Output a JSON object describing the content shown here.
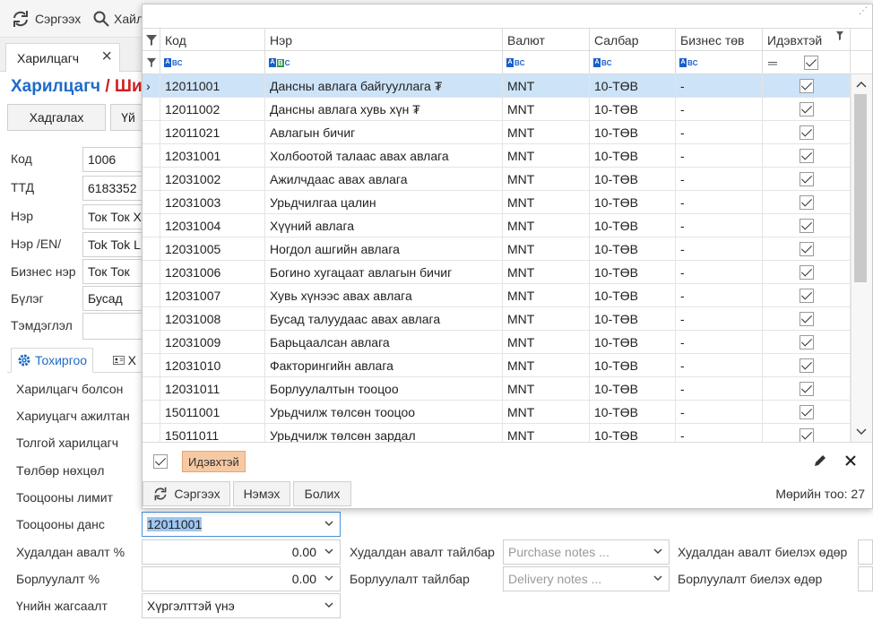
{
  "toolbar": {
    "refresh_label": "Сэргээх",
    "search_label": "Хайл"
  },
  "doc_tab": {
    "label": "Харилцагч"
  },
  "page_title": {
    "main": "Харилцагч",
    "sub": "/ Ши"
  },
  "actions": {
    "save_label": "Хадгалах",
    "other_label": "Үй"
  },
  "form": {
    "code": {
      "label": "Код",
      "value": "1006"
    },
    "ttd": {
      "label": "ТТД",
      "value": "6183352"
    },
    "name": {
      "label": "Нэр",
      "value": "Ток Ток Х"
    },
    "name_en": {
      "label": "Нэр /EN/",
      "value": "Tok Tok L"
    },
    "business_name": {
      "label": "Бизнес нэр",
      "value": "Ток Ток"
    },
    "group": {
      "label": "Бүлэг",
      "value": "Бусад"
    },
    "note": {
      "label": "Тэмдэглэл",
      "value": ""
    }
  },
  "section_tabs": {
    "settings": "Тохиргоо",
    "other": "Х"
  },
  "settings": {
    "became_customer": "Харилцагч болсон",
    "responsible_employee": "Хариуцагч ажилтан",
    "head_customer": "Толгой харилцагч",
    "payment_terms": "Төлбөр нөхцөл",
    "credit_limit": "Тооцооны лимит",
    "account": {
      "label": "Тооцооны данс",
      "value": "12011001"
    },
    "purchase_pct": {
      "label": "Худалдан авалт %",
      "value": "0.00"
    },
    "sales_pct": {
      "label": "Борлуулалт %",
      "value": "0.00"
    },
    "price_list": {
      "label": "Үнийн жагсаалт",
      "value": "Хүргэлттэй үнэ"
    },
    "purchase_note": {
      "label": "Худалдан авалт тайлбар",
      "placeholder": "Purchase notes ..."
    },
    "delivery_note": {
      "label": "Борлуулалт тайлбар",
      "placeholder": "Delivery notes ..."
    },
    "purchase_days": {
      "label": "Худалдан авалт биелэх өдөр"
    },
    "sales_days": {
      "label": "Борлуулалт биелэх өдөр"
    }
  },
  "popup": {
    "columns": [
      "Код",
      "Нэр",
      "Валют",
      "Салбар",
      "Бизнес төв",
      "Идэвхтэй"
    ],
    "rows": [
      {
        "code": "12011001",
        "name": "Дансны авлага байгууллага ₮",
        "currency": "MNT",
        "branch": "10-ТӨВ",
        "bc": "-",
        "active": true
      },
      {
        "code": "12011002",
        "name": "Дансны авлага хувь хүн ₮",
        "currency": "MNT",
        "branch": "10-ТӨВ",
        "bc": "-",
        "active": true
      },
      {
        "code": "12011021",
        "name": "Авлагын бичиг",
        "currency": "MNT",
        "branch": "10-ТӨВ",
        "bc": "-",
        "active": true
      },
      {
        "code": "12031001",
        "name": "Холбоотой талаас авах авлага",
        "currency": "MNT",
        "branch": "10-ТӨВ",
        "bc": "-",
        "active": true
      },
      {
        "code": "12031002",
        "name": "Ажилчдаас авах авлага",
        "currency": "MNT",
        "branch": "10-ТӨВ",
        "bc": "-",
        "active": true
      },
      {
        "code": "12031003",
        "name": "Урьдчилгаа цалин",
        "currency": "MNT",
        "branch": "10-ТӨВ",
        "bc": "-",
        "active": true
      },
      {
        "code": "12031004",
        "name": "Хүүний авлага",
        "currency": "MNT",
        "branch": "10-ТӨВ",
        "bc": "-",
        "active": true
      },
      {
        "code": "12031005",
        "name": "Ногдол ашгийн авлага",
        "currency": "MNT",
        "branch": "10-ТӨВ",
        "bc": "-",
        "active": true
      },
      {
        "code": "12031006",
        "name": "Богино хугацаат авлагын бичиг",
        "currency": "MNT",
        "branch": "10-ТӨВ",
        "bc": "-",
        "active": true
      },
      {
        "code": "12031007",
        "name": "Хувь хүнээс авах авлага",
        "currency": "MNT",
        "branch": "10-ТӨВ",
        "bc": "-",
        "active": true
      },
      {
        "code": "12031008",
        "name": "Бусад талуудаас авах авлага",
        "currency": "MNT",
        "branch": "10-ТӨВ",
        "bc": "-",
        "active": true
      },
      {
        "code": "12031009",
        "name": "Барьцаалсан авлага",
        "currency": "MNT",
        "branch": "10-ТӨВ",
        "bc": "-",
        "active": true
      },
      {
        "code": "12031010",
        "name": "Факторингийн авлага",
        "currency": "MNT",
        "branch": "10-ТӨВ",
        "bc": "-",
        "active": true
      },
      {
        "code": "12031011",
        "name": "Борлуулалтын тооцоо",
        "currency": "MNT",
        "branch": "10-ТӨВ",
        "bc": "-",
        "active": true
      },
      {
        "code": "15011001",
        "name": "Урьдчилж төлсөн тооцоо",
        "currency": "MNT",
        "branch": "10-ТӨВ",
        "bc": "-",
        "active": true
      },
      {
        "code": "15011011",
        "name": "Урьдчилж төлсөн зардал",
        "currency": "MNT",
        "branch": "10-ТӨВ",
        "bc": "-",
        "active": true
      }
    ],
    "filter_badge": "Идэвхтэй",
    "refresh_label": "Сэргээх",
    "add_label": "Нэмэх",
    "cancel_label": "Болих",
    "count_label": "Мөрийн тоо: 27"
  }
}
